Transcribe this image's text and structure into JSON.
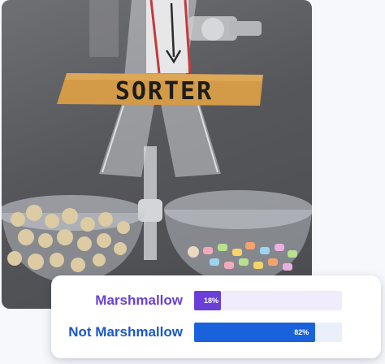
{
  "photo": {
    "label_text": "SORTER"
  },
  "results": [
    {
      "name": "Marshmallow",
      "value": 0.18,
      "percent_label": "18%",
      "text_color": "#6a3fd8",
      "fill_color": "#6a3fd8",
      "track_color": "#f1ecfb"
    },
    {
      "name": "Not Marshmallow",
      "value": 0.82,
      "percent_label": "82%",
      "text_color": "#1a57c9",
      "fill_color": "#1a62db",
      "track_color": "#e9effb"
    }
  ]
}
